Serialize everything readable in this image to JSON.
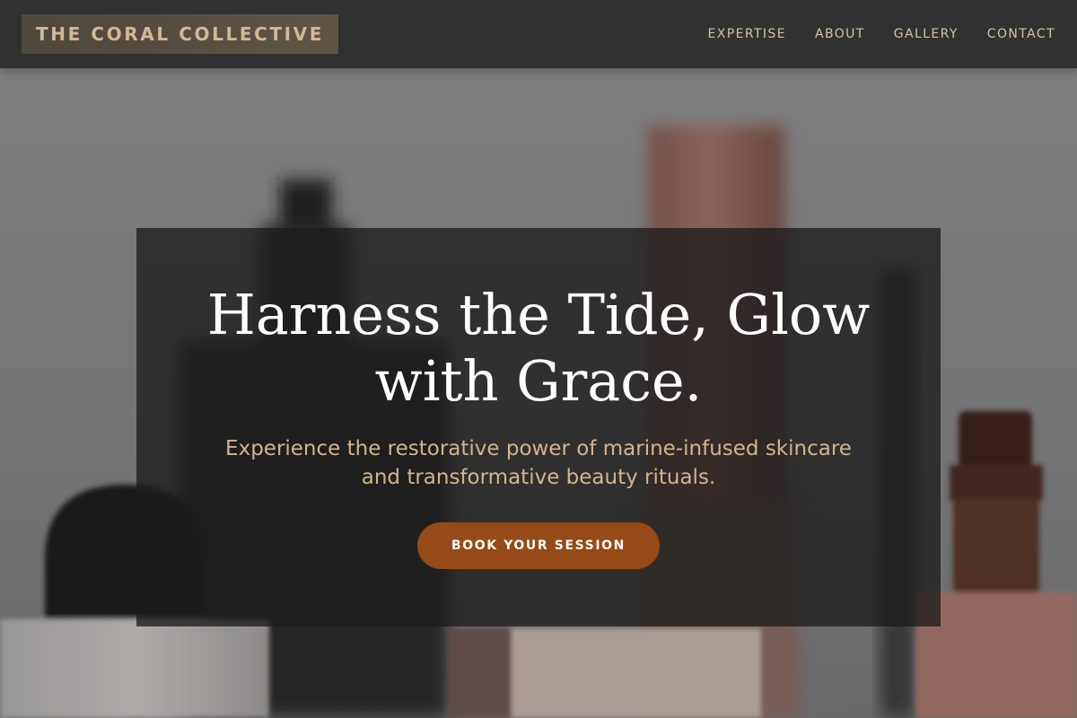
{
  "header": {
    "brand": "THE CORAL COLLECTIVE",
    "nav": [
      {
        "label": "EXPERTISE"
      },
      {
        "label": "ABOUT"
      },
      {
        "label": "GALLERY"
      },
      {
        "label": "CONTACT"
      }
    ]
  },
  "hero": {
    "title_lines": [
      "Harness the Tide, Glow",
      "with Grace."
    ],
    "subtitle_lines": [
      "Experience the restorative power of marine-infused skincare",
      "and transformative beauty rituals."
    ],
    "cta_label": "BOOK YOUR SESSION"
  },
  "colors": {
    "navbar_bg": "#313131",
    "brand_text": "#d2b894",
    "nav_text": "#d6c3a6",
    "subtitle_text": "#d4b48e",
    "cta_bg": "#954a17",
    "cta_text": "#ffffff"
  }
}
